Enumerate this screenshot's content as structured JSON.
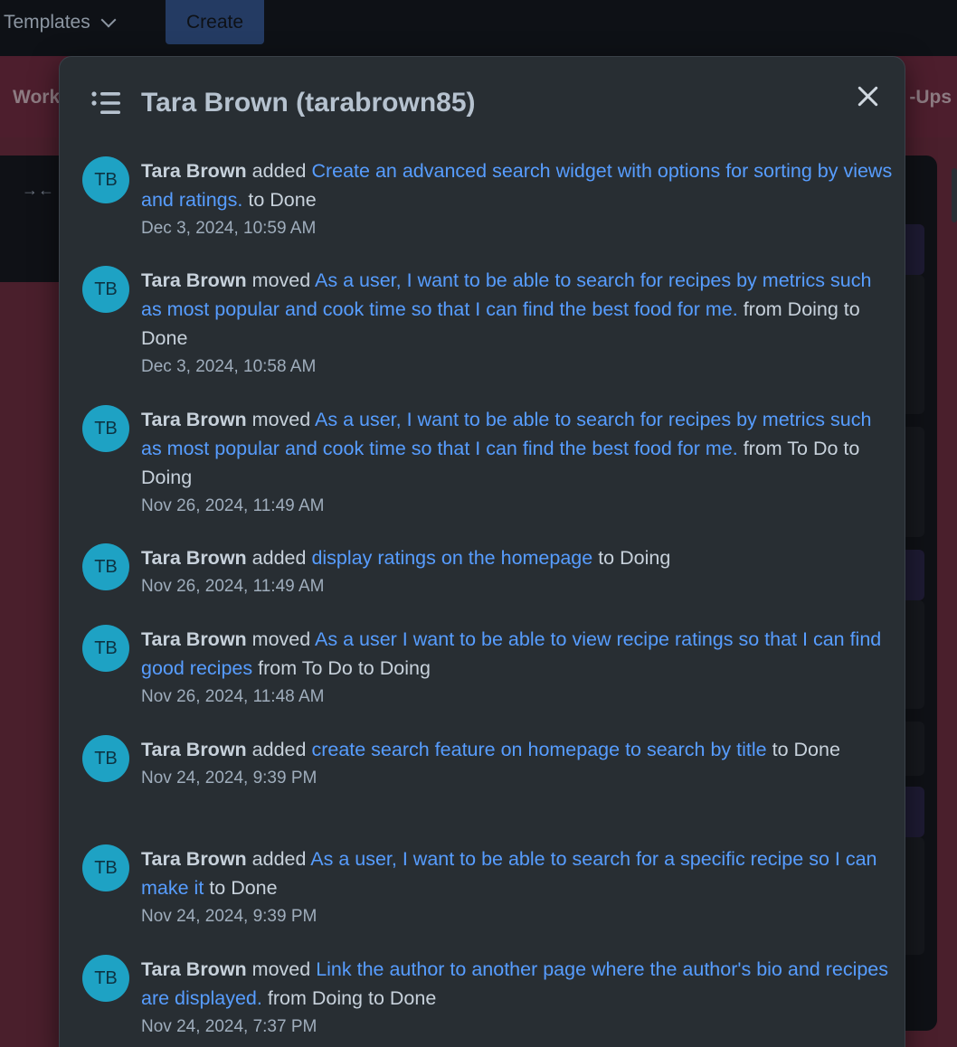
{
  "background": {
    "templates_label": "Templates",
    "create_label": "Create",
    "board_name": "Work",
    "right_label": "-Ups"
  },
  "modal": {
    "title": "Tara Brown (tarabrown85)",
    "activities": [
      {
        "initials": "TB",
        "actor": "Tara Brown",
        "verb": "added",
        "card": "Create an advanced search widget with options for sorting by views and ratings.",
        "suffix": "to Done",
        "time": "Dec 3, 2024, 10:59 AM"
      },
      {
        "initials": "TB",
        "actor": "Tara Brown",
        "verb": "moved",
        "card": "As a user, I want to be able to search for recipes by metrics such as most popular and cook time so that I can find the best food for me.",
        "suffix": "from Doing to Done",
        "time": "Dec 3, 2024, 10:58 AM"
      },
      {
        "initials": "TB",
        "actor": "Tara Brown",
        "verb": "moved",
        "card": "As a user, I want to be able to search for recipes by metrics such as most popular and cook time so that I can find the best food for me.",
        "suffix": "from To Do to Doing",
        "time": "Nov 26, 2024, 11:49 AM"
      },
      {
        "initials": "TB",
        "actor": "Tara Brown",
        "verb": "added",
        "card": "display ratings on the homepage",
        "suffix": "to Doing",
        "time": "Nov 26, 2024, 11:49 AM"
      },
      {
        "initials": "TB",
        "actor": "Tara Brown",
        "verb": "moved",
        "card": "As a user I want to be able to view recipe ratings so that I can find good recipes",
        "suffix": "from To Do to Doing",
        "time": "Nov 26, 2024, 11:48 AM"
      },
      {
        "initials": "TB",
        "actor": "Tara Brown",
        "verb": "added",
        "card": "create search feature on homepage to search by title",
        "suffix": "to Done",
        "time": "Nov 24, 2024, 9:39 PM"
      },
      {
        "initials": "TB",
        "actor": "Tara Brown",
        "verb": "added",
        "card": "As a user, I want to be able to search for a specific recipe so I can make it",
        "suffix": "to Done",
        "time": "Nov 24, 2024, 9:39 PM"
      },
      {
        "initials": "TB",
        "actor": "Tara Brown",
        "verb": "moved",
        "card": "Link the author to another page where the author's bio and recipes are displayed.",
        "suffix": "from Doing to Done",
        "time": "Nov 24, 2024, 7:37 PM"
      }
    ]
  }
}
